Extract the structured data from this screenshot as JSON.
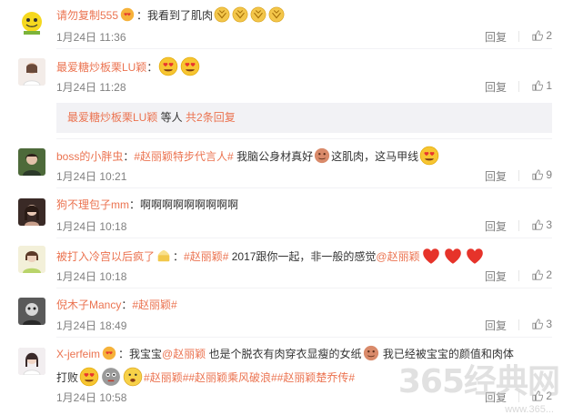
{
  "comments": [
    {
      "user": "请勿复制555",
      "text": "：我看到了肌肉",
      "time": "1月24日 11:36",
      "reply": "回复",
      "likes": "2",
      "avatar_icon": "avatar-yellow-emoji",
      "vip_icon": "vip-badge-icon",
      "trailing_emojis": [
        "bow-emoji",
        "bow-emoji",
        "bow-emoji",
        "bow-emoji"
      ]
    },
    {
      "user": "最爱糖炒板栗LU颖",
      "text": "：",
      "time": "1月24日 11:28",
      "reply": "回复",
      "likes": "1",
      "trailing_emojis": [
        "heart-eyes-emoji",
        "heart-eyes-emoji"
      ]
    },
    {
      "user": "boss的小胖虫",
      "text_parts": [
        "：",
        "#赵丽颖特步代言人#",
        " 我脑公身材真好",
        "这肌肉，这马甲线"
      ],
      "time": "1月24日 10:21",
      "reply": "回复",
      "likes": "9"
    },
    {
      "user": "狗不理包子mm",
      "text": "：啊啊啊啊啊啊啊啊啊",
      "time": "1月24日 10:18",
      "reply": "回复",
      "likes": "3"
    },
    {
      "user": "被打入冷宫以后疯了",
      "text_parts": [
        "：",
        "#赵丽颖#",
        " 2017跟你一起，非一般的感觉",
        "@赵丽颖"
      ],
      "time": "1月24日 10:18",
      "reply": "回复",
      "likes": "2"
    },
    {
      "user": "倪木子Mancy",
      "text_parts": [
        "：",
        "#赵丽颖#"
      ],
      "time": "1月24日 18:49",
      "reply": "回复",
      "likes": "3"
    },
    {
      "user": "X-jerfeim",
      "text_parts": [
        "：我宝宝",
        "@赵丽颖",
        " 也是个脱衣有肉穿衣显瘦的女纸",
        " 我已经被宝宝的颜值和肉体"
      ],
      "text_line2_parts": [
        "打败",
        "#赵丽颖#",
        "#赵丽颖乘风破浪#",
        "#赵丽颖楚乔传#"
      ],
      "time": "1月24日 10:58",
      "reply": "回复",
      "likes": "2"
    }
  ],
  "sub_reply": {
    "user": "最爱糖炒板栗LU颖",
    "suffix": " 等人 ",
    "link": "共2条回复"
  },
  "watermark": {
    "main": "365经典网",
    "sub": "www.365..."
  },
  "colors": {
    "accent": "#eb7350",
    "muted": "#808080",
    "subbox_bg": "#f2f2f5"
  }
}
